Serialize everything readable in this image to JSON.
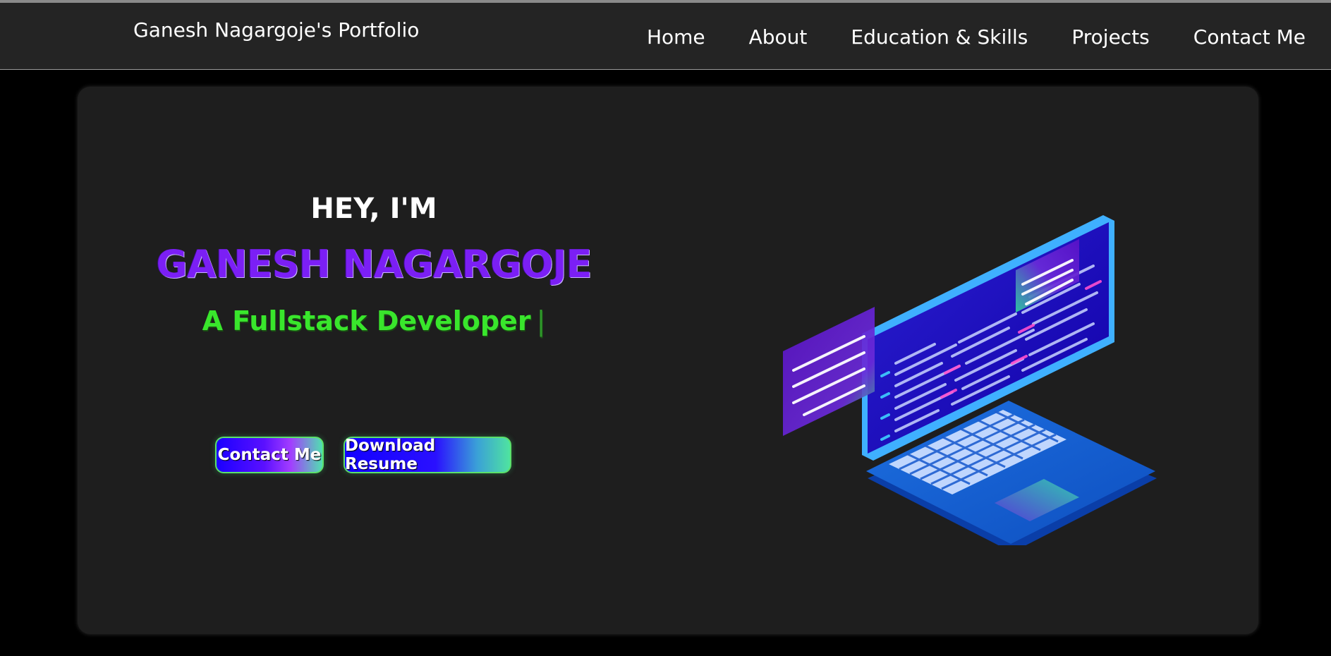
{
  "header": {
    "brand": "Ganesh Nagargoje's Portfolio",
    "nav": [
      {
        "label": "Home"
      },
      {
        "label": "About"
      },
      {
        "label": "Education & Skills"
      },
      {
        "label": "Projects"
      },
      {
        "label": "Contact Me"
      }
    ]
  },
  "hero": {
    "greeting": "HEY, I'M",
    "name": "GANESH NAGARGOJE",
    "role": "A Fullstack Developer",
    "cursor": "|",
    "buttons": {
      "contact": "Contact Me",
      "resume": "Download Resume"
    },
    "illustration": {
      "icon": "laptop-code-illustration"
    }
  },
  "colors": {
    "page_bg": "#000000",
    "header_bg": "#242424",
    "card_bg": "#1e1e1e",
    "name": "#7b1ff5",
    "role": "#39e62c",
    "button_start": "#1a00ff",
    "button_end": "#4fe3a0"
  }
}
